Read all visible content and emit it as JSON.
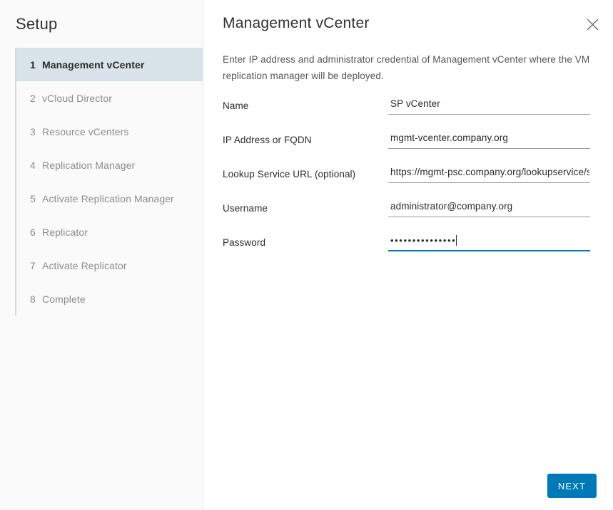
{
  "sidebar": {
    "title": "Setup",
    "steps": [
      {
        "num": "1",
        "label": "Management vCenter",
        "active": true
      },
      {
        "num": "2",
        "label": "vCloud Director",
        "active": false
      },
      {
        "num": "3",
        "label": "Resource vCenters",
        "active": false
      },
      {
        "num": "4",
        "label": "Replication Manager",
        "active": false
      },
      {
        "num": "5",
        "label": "Activate Replication Manager",
        "active": false
      },
      {
        "num": "6",
        "label": "Replicator",
        "active": false
      },
      {
        "num": "7",
        "label": "Activate Replicator",
        "active": false
      },
      {
        "num": "8",
        "label": "Complete",
        "active": false
      }
    ]
  },
  "panel": {
    "title": "Management vCenter",
    "description": "Enter IP address and administrator credential of Management vCenter where the VM replication manager will be deployed.",
    "close_icon": "close-icon"
  },
  "form": {
    "fields": [
      {
        "name": "name",
        "label": "Name",
        "value": "SP vCenter",
        "placeholder": "",
        "type": "text",
        "focused": false
      },
      {
        "name": "ip-address",
        "label": "IP Address or FQDN",
        "value": "mgmt-vcenter.company.org",
        "placeholder": "",
        "type": "text",
        "focused": false
      },
      {
        "name": "lookup-service-url",
        "label": "Lookup Service URL (optional)",
        "value": "https://mgmt-psc.company.org/lookupservice/sdk",
        "placeholder": "",
        "type": "text",
        "focused": false
      },
      {
        "name": "username",
        "label": "Username",
        "value": "administrator@company.org",
        "placeholder": "",
        "type": "text",
        "focused": false
      },
      {
        "name": "password",
        "label": "Password",
        "value": "•••••••••••••••",
        "masked_length": 15,
        "placeholder": "",
        "type": "password",
        "focused": true
      }
    ]
  },
  "footer": {
    "next_label": "NEXT"
  },
  "colors": {
    "accent": "#0079b8",
    "sidebar_bg": "#fafafa",
    "active_step_bg": "#d9e4ea",
    "text_primary": "#2b2b2b",
    "text_muted": "#8c8c8c",
    "underline": "#9a9a9a"
  }
}
